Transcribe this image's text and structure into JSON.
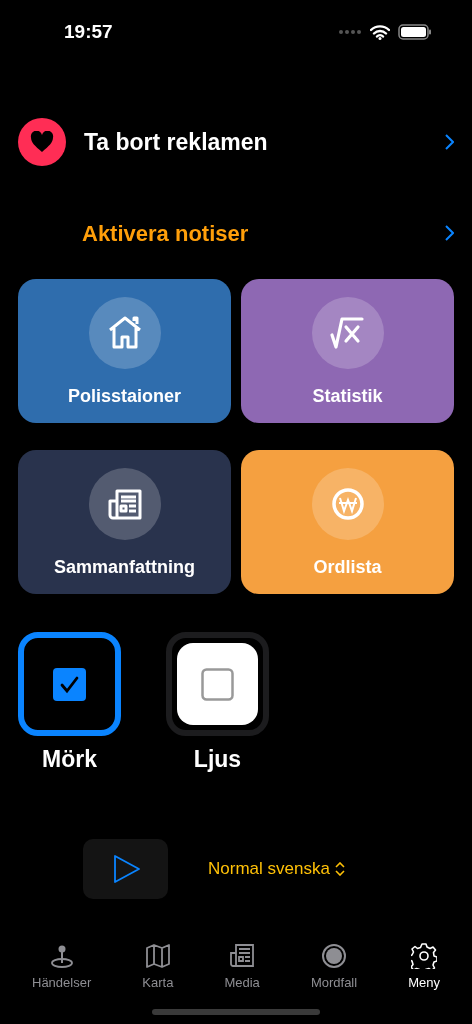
{
  "status_bar": {
    "time": "19:57"
  },
  "remove_ads": {
    "label": "Ta bort reklamen"
  },
  "notifications": {
    "label": "Aktivera notiser"
  },
  "tiles": [
    {
      "label": "Polisstaioner",
      "kind": "house",
      "color": "#2f6dad"
    },
    {
      "label": "Statistik",
      "kind": "sqrt",
      "color": "#8e68b3"
    },
    {
      "label": "Sammanfattning",
      "kind": "newspaper",
      "color": "#29334d"
    },
    {
      "label": "Ordlista",
      "kind": "won",
      "color": "#f5a040"
    }
  ],
  "themes": [
    {
      "label": "Mörk",
      "kind": "dark",
      "selected": true
    },
    {
      "label": "Ljus",
      "kind": "light",
      "selected": false
    }
  ],
  "voice": {
    "value": "Normal svenska"
  },
  "tab_bar": [
    {
      "label": "Händelser",
      "kind": "pin",
      "selected": false
    },
    {
      "label": "Karta",
      "kind": "map",
      "selected": false
    },
    {
      "label": "Media",
      "kind": "newspaper",
      "selected": false
    },
    {
      "label": "Mordfall",
      "kind": "record",
      "selected": false
    },
    {
      "label": "Meny",
      "kind": "gear",
      "selected": true
    }
  ]
}
